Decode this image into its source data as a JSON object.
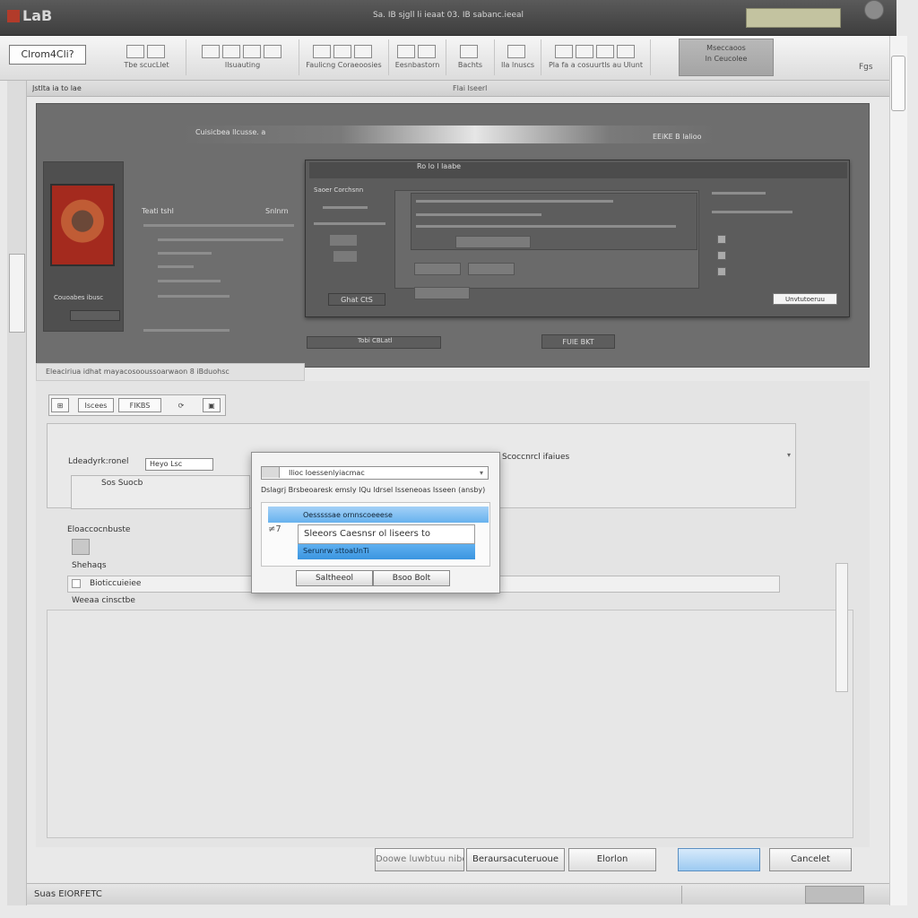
{
  "titlebar": {
    "logo": "LaB",
    "title": "Sa. IB sjgll li ieaat 03. IB sabanc.ieeal"
  },
  "ribbon": {
    "home_tab": "Clrom4Cli?",
    "groups": [
      {
        "label": "Tbe scucLlet"
      },
      {
        "label": "Ilsuauting"
      },
      {
        "label": "Faulicng Coraeoosies"
      },
      {
        "label": "Eesnbastorn"
      },
      {
        "label": "Bachts"
      },
      {
        "label": "Ila lnuscs"
      },
      {
        "label": "Pla fa a cosuurtls au Ulunt"
      }
    ],
    "selected_group": {
      "label1": "Mseccaoos",
      "label2": "ln Ceucolee"
    },
    "search": "Fgs"
  },
  "subheader": {
    "breadcrumb": "Jstlta ia to lae",
    "tab": "Flai Iseerl"
  },
  "preview": {
    "path": "Cuisicbea llcusse. a",
    "right_label": "EEiKE B lalioo",
    "portrait_caption": "Couoabes ibusc",
    "column_title": "Teati tshl",
    "column_right": "Snlnrn",
    "inner_title": "Ro lo l laabe",
    "inner_left_btn": "Ghat CtS",
    "inner_label_top": "Saoer Corchsnn",
    "inner_ok": "Unvtutoeruu",
    "status_a": "Tobi CBLatl",
    "status_b": "FUlE BKT"
  },
  "section_label": "Eleaciriua idhat    mayacosooussoarwaon 8    iBduohsc",
  "toolbar2": {
    "btn1": "⊞",
    "btn2": "Iscees",
    "btn3": "FIKBS",
    "btn4": "⟳",
    "btn5": "▣"
  },
  "form": {
    "field1_label": "Ldeadyrk:ronel",
    "field1_value": "Heyo Lsc",
    "field_right_label": "Scoccnrcl ifaiues",
    "subbox_label": "Sos Suocb",
    "list_label": "Eloaccocnbuste",
    "list_caption": "Shehaqs",
    "list_row": "Bioticcuieiee",
    "list_row_sub": "Weeaa cinsctbe"
  },
  "modal": {
    "combo_value": "Ilioc Ioessenlyiacmac",
    "description": "Dslagrj Brsbeoaresk emsly IQu ldrsel Isseneoas Isseen (ansby)",
    "highlight1": "Oesssssae ornnscoeeese",
    "arrow": "≠7",
    "item": "Sleeors  Caesnsr ol liseers to",
    "highlight2": "Serunrw sttoaUnTi",
    "button1": "Saltheeol",
    "button2": "Bsoo Bolt"
  },
  "bottom_buttons": {
    "btn1": "Doowe luwbtuu nibe",
    "btn2": "Beraursacuteruoue",
    "btn3": "Elorlon",
    "btn4": "",
    "btn5": "Cancelet"
  },
  "status": {
    "text": "Suas EIORFETC"
  },
  "colors": {
    "titlebar": "#4a4a4a",
    "accent_blue": "#5fb0f0",
    "preview_panel": "#6e6e6e",
    "portrait_red": "#a42a1e"
  }
}
